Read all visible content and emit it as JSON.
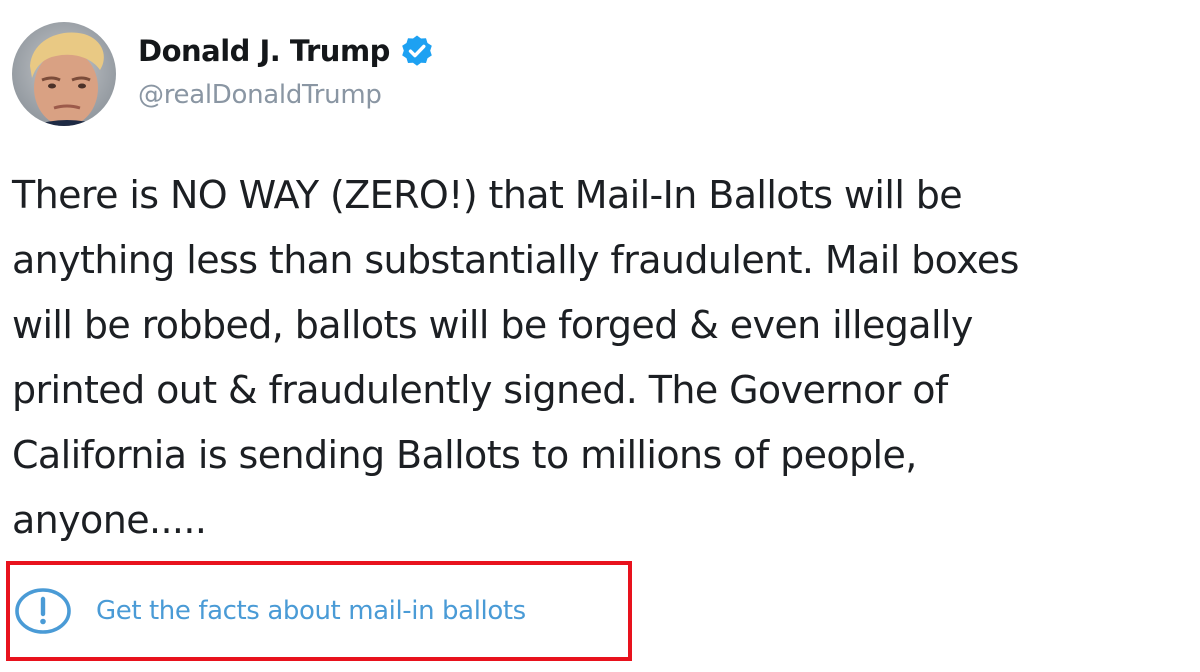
{
  "author": {
    "name": "Donald J. Trump",
    "handle": "@realDonaldTrump",
    "verified": true,
    "avatar_icon": "profile-photo-avatar"
  },
  "tweet": {
    "text": "There is NO WAY (ZERO!) that Mail-In Ballots will be\nanything less than substantially fraudulent. Mail boxes\nwill be robbed, ballots will be forged & even illegally\nprinted out & fraudulently signed. The Governor of\nCalifornia is sending Ballots to millions of people,\nanyone....."
  },
  "fact_check": {
    "label": "Get the facts about mail-in ballots",
    "icon": "exclamation-circle-icon",
    "highlight_color": "#e8121d",
    "link_color": "#4a9bd6"
  },
  "colors": {
    "verified_badge": "#1da1f2",
    "text_primary": "#1c1f23",
    "text_secondary": "#8a96a3"
  }
}
